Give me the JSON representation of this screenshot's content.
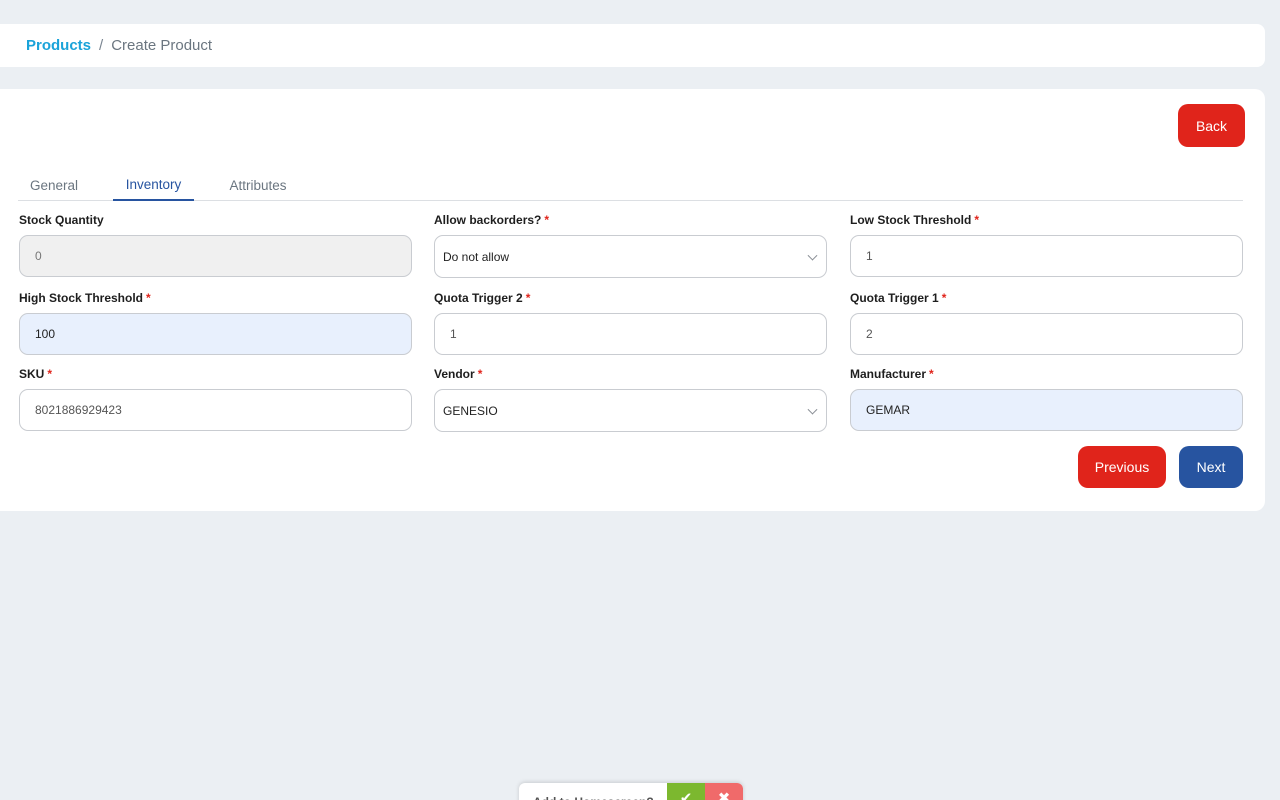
{
  "breadcrumb": {
    "root": "Products",
    "separator": "/",
    "current": "Create Product"
  },
  "actions": {
    "back": "Back",
    "previous": "Previous",
    "next": "Next"
  },
  "tabs": [
    {
      "label": "General",
      "active": false
    },
    {
      "label": "Inventory",
      "active": true
    },
    {
      "label": "Attributes",
      "active": false
    }
  ],
  "fields": {
    "stock_quantity": {
      "label": "Stock Quantity",
      "required": "",
      "value": "0"
    },
    "allow_backorders": {
      "label": "Allow backorders?",
      "required": "*",
      "value": "Do not allow"
    },
    "low_stock_threshold": {
      "label": "Low Stock Threshold",
      "required": "*",
      "value": "1"
    },
    "high_stock_threshold": {
      "label": "High Stock Threshold",
      "required": "*",
      "value": "100"
    },
    "quota_trigger_2": {
      "label": "Quota Trigger 2",
      "required": "*",
      "value": "1"
    },
    "quota_trigger_1": {
      "label": "Quota Trigger 1",
      "required": "*",
      "value": "2"
    },
    "sku": {
      "label": "SKU",
      "required": "*",
      "value": "8021886929423"
    },
    "vendor": {
      "label": "Vendor",
      "required": "*",
      "value": "GENESIO"
    },
    "manufacturer": {
      "label": "Manufacturer",
      "required": "*",
      "value": "GEMAR"
    }
  },
  "home_prompt": {
    "text": "Add to Homescreen?",
    "confirm_icon": "check-icon",
    "dismiss_icon": "close-icon"
  },
  "colors": {
    "primary_blue": "#2754a0",
    "danger_red": "#e0241b",
    "link_cyan": "#1aa3d9",
    "background": "#ebeff3"
  }
}
